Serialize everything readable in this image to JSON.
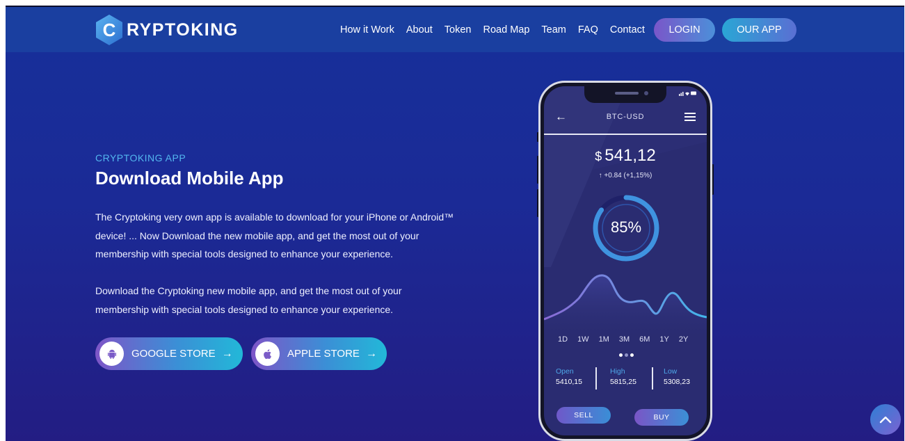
{
  "brand": {
    "logo_letter": "C",
    "name": "RYPTOKING"
  },
  "nav": {
    "items": [
      {
        "label": "How it Work"
      },
      {
        "label": "About"
      },
      {
        "label": "Token"
      },
      {
        "label": "Road Map"
      },
      {
        "label": "Team"
      },
      {
        "label": "FAQ"
      },
      {
        "label": "Contact"
      }
    ],
    "login_label": "LOGIN",
    "ourapp_label": "OUR APP"
  },
  "hero": {
    "eyebrow": "CRYPTOKING APP",
    "title": "Download Mobile App",
    "paragraph1": "The Cryptoking very own app is available to download for your iPhone or Android™ device! ... Now Download the new mobile app, and get the most out of your membership with special tools designed to enhance your experience.",
    "paragraph2": "Download the Cryptoking new mobile app, and get the most out of your membership with special tools designed to enhance your experience.",
    "google_store_label": "GOOGLE STORE",
    "apple_store_label": "APPLE STORE",
    "arrow": "→"
  },
  "phone": {
    "pair": "BTC-USD",
    "currency_symbol": "$",
    "price": "541,12",
    "change": "↑ +0.84 (+1,15%)",
    "progress_text": "85%",
    "progress_value": 0.85,
    "ranges": [
      "1D",
      "1W",
      "1M",
      "3M",
      "6M",
      "1Y",
      "2Y"
    ],
    "stats": {
      "open_label": "Open",
      "open_value": "5410,15",
      "high_label": "High",
      "high_value": "5815,25",
      "low_label": "Low",
      "low_value": "5308,23"
    },
    "sell_label": "SELL",
    "buy_label": "BUY"
  },
  "colors": {
    "accent_blue": "#53b7ef",
    "background": "#1b2a96",
    "header": "#1a3fa0"
  }
}
